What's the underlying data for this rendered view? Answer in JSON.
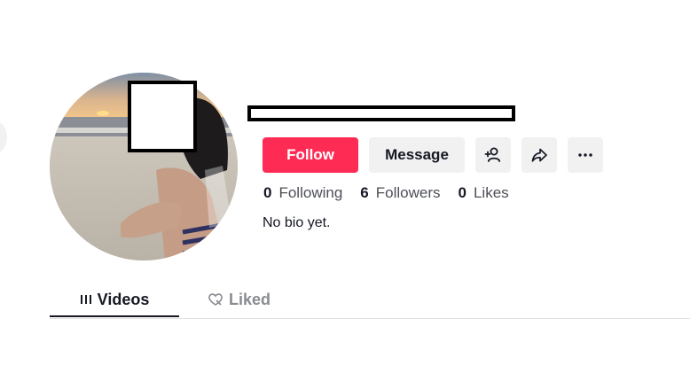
{
  "profile": {
    "avatar_icon": "avatar-photo",
    "follow_label": "Follow",
    "message_label": "Message",
    "bio": "No bio yet."
  },
  "actions": {
    "add_friend_icon": "person-plus-icon",
    "share_icon": "share-arrow-icon",
    "more_icon": "ellipsis-icon"
  },
  "stats": [
    {
      "value": "0",
      "label": "Following"
    },
    {
      "value": "6",
      "label": "Followers"
    },
    {
      "value": "0",
      "label": "Likes"
    }
  ],
  "tabs": [
    {
      "label": "Videos",
      "icon": "grid-bars-icon",
      "active": true
    },
    {
      "label": "Liked",
      "icon": "heart-outline-icon",
      "active": false
    }
  ],
  "colors": {
    "accent": "#fe2c55",
    "text": "#161823",
    "muted": "#8a8b91",
    "button_gray": "#f1f1f2"
  }
}
